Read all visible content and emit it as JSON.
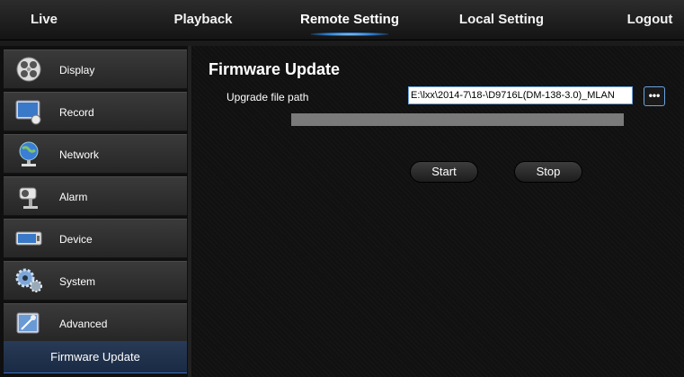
{
  "nav": {
    "live": "Live",
    "playback": "Playback",
    "remote_setting": "Remote Setting",
    "local_setting": "Local Setting",
    "logout": "Logout",
    "active": "Remote Setting"
  },
  "sidebar": {
    "items": [
      {
        "label": "Display",
        "icon": "display-icon"
      },
      {
        "label": "Record",
        "icon": "record-icon"
      },
      {
        "label": "Network",
        "icon": "network-icon"
      },
      {
        "label": "Alarm",
        "icon": "alarm-icon"
      },
      {
        "label": "Device",
        "icon": "device-icon"
      },
      {
        "label": "System",
        "icon": "system-icon"
      },
      {
        "label": "Advanced",
        "icon": "advanced-icon"
      }
    ],
    "sub_item": "Firmware Update"
  },
  "main": {
    "title": "Firmware Update",
    "upgrade_label": "Upgrade file path",
    "upgrade_path": "E:\\lxx\\2014-7\\18-\\D9716L(DM-138-3.0)_MLAN",
    "browse_label": "•••",
    "progress": 0,
    "start_label": "Start",
    "stop_label": "Stop"
  },
  "colors": {
    "accent": "#3a8ee6",
    "background": "#111111"
  }
}
